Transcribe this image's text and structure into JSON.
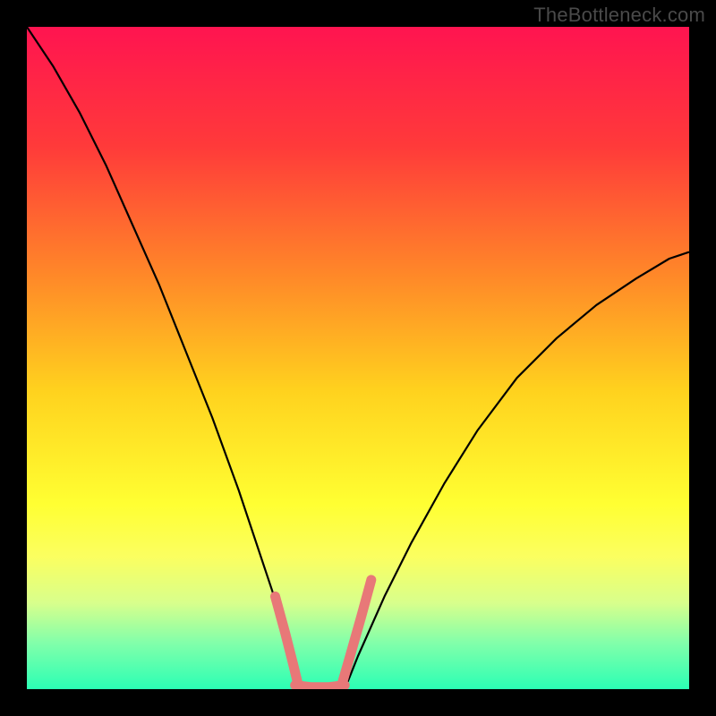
{
  "watermark": "TheBottleneck.com",
  "chart_data": {
    "type": "line",
    "title": "",
    "xlabel": "",
    "ylabel": "",
    "xlim": [
      0,
      100
    ],
    "ylim": [
      0,
      100
    ],
    "grid": false,
    "gradient_stops": [
      {
        "offset": 0.0,
        "color": "#ff1450"
      },
      {
        "offset": 0.18,
        "color": "#ff3a3a"
      },
      {
        "offset": 0.38,
        "color": "#ff8a28"
      },
      {
        "offset": 0.55,
        "color": "#ffd21e"
      },
      {
        "offset": 0.72,
        "color": "#ffff32"
      },
      {
        "offset": 0.8,
        "color": "#fbff60"
      },
      {
        "offset": 0.87,
        "color": "#d8ff8c"
      },
      {
        "offset": 0.93,
        "color": "#82ffaa"
      },
      {
        "offset": 1.0,
        "color": "#2bffb4"
      }
    ],
    "series": [
      {
        "name": "left-curve",
        "stroke": "#000000",
        "width": 2.2,
        "x": [
          0,
          4,
          8,
          12,
          16,
          20,
          24,
          28,
          32,
          36,
          38,
          40,
          41
        ],
        "y": [
          100,
          94,
          87,
          79,
          70,
          61,
          51,
          41,
          30,
          18,
          12,
          5,
          0
        ]
      },
      {
        "name": "right-curve",
        "stroke": "#000000",
        "width": 2.2,
        "x": [
          48,
          50,
          54,
          58,
          63,
          68,
          74,
          80,
          86,
          92,
          97,
          100
        ],
        "y": [
          0,
          5,
          14,
          22,
          31,
          39,
          47,
          53,
          58,
          62,
          65,
          66
        ]
      },
      {
        "name": "pink-left-tip",
        "stroke": "#e87878",
        "width": 11,
        "cap": "round",
        "x": [
          37.5,
          39.0,
          40.2,
          41.0
        ],
        "y": [
          14.0,
          8.5,
          3.8,
          0.5
        ]
      },
      {
        "name": "pink-bottom",
        "stroke": "#e87878",
        "width": 11,
        "cap": "round",
        "x": [
          40.5,
          43.0,
          45.5,
          48.0
        ],
        "y": [
          0.6,
          0.3,
          0.3,
          0.6
        ]
      },
      {
        "name": "pink-right-tip",
        "stroke": "#e87878",
        "width": 11,
        "cap": "round",
        "x": [
          47.5,
          48.8,
          50.5,
          52.0
        ],
        "y": [
          0.5,
          5.0,
          11.0,
          16.5
        ]
      }
    ]
  }
}
